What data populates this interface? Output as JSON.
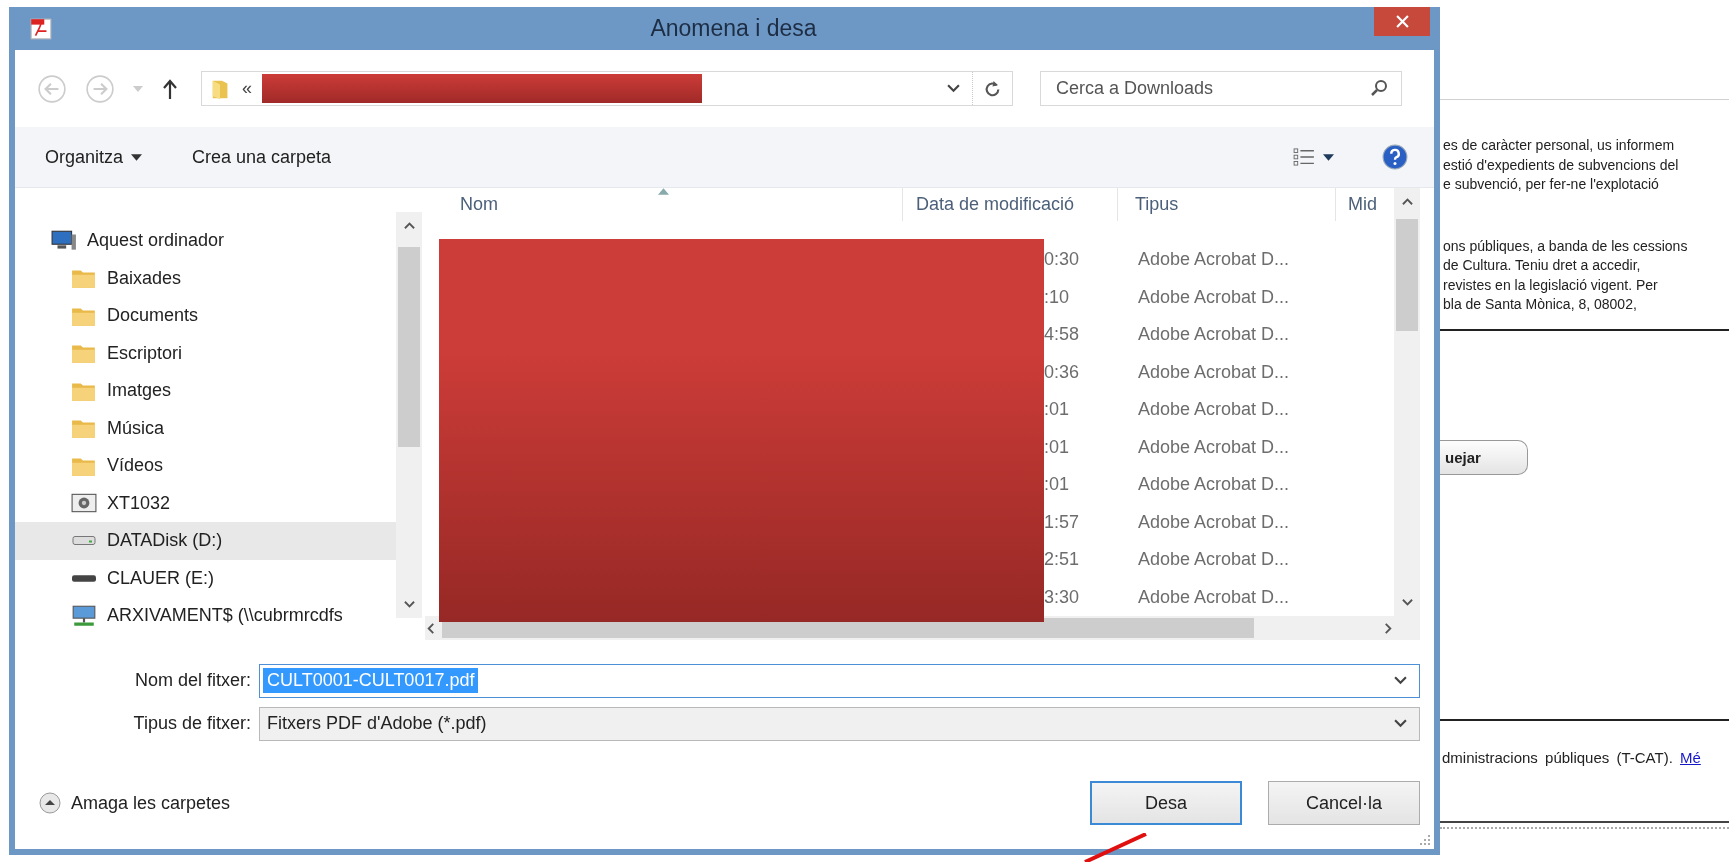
{
  "window": {
    "title": "Anomena i desa"
  },
  "address_bar": {
    "prefix": "«"
  },
  "search": {
    "placeholder": "Cerca a Downloads"
  },
  "toolbar": {
    "organize": "Organitza",
    "new_folder": "Crea una carpeta"
  },
  "navigation": [
    {
      "label": "Aquest ordinador",
      "kind": "computer",
      "selected": false,
      "children": [
        {
          "label": "Baixades",
          "kind": "folder",
          "selected": false
        },
        {
          "label": "Documents",
          "kind": "folder",
          "selected": false
        },
        {
          "label": "Escriptori",
          "kind": "folder",
          "selected": false
        },
        {
          "label": "Imatges",
          "kind": "folder",
          "selected": false
        },
        {
          "label": "Música",
          "kind": "folder",
          "selected": false
        },
        {
          "label": "Vídeos",
          "kind": "folder",
          "selected": false
        },
        {
          "label": "XT1032",
          "kind": "device",
          "selected": false
        },
        {
          "label": "DATADisk (D:)",
          "kind": "drive",
          "selected": true
        },
        {
          "label": "CLAUER (E:)",
          "kind": "removable",
          "selected": false
        },
        {
          "label": "ARXIVAMENT$ (\\\\cubrmrcdfs",
          "kind": "network",
          "selected": false
        }
      ]
    }
  ],
  "columns": [
    {
      "label": "Nom",
      "sorted": true
    },
    {
      "label": "Data de modificació",
      "sorted": false
    },
    {
      "label": "Tipus",
      "sorted": false
    },
    {
      "label": "Mid",
      "sorted": false
    }
  ],
  "rows": [
    {
      "date": "0:30",
      "type": "Adobe Acrobat D..."
    },
    {
      "date": ":10",
      "type": "Adobe Acrobat D..."
    },
    {
      "date": "4:58",
      "type": "Adobe Acrobat D..."
    },
    {
      "date": "0:36",
      "type": "Adobe Acrobat D..."
    },
    {
      "date": ":01",
      "type": "Adobe Acrobat D..."
    },
    {
      "date": ":01",
      "type": "Adobe Acrobat D..."
    },
    {
      "date": ":01",
      "type": "Adobe Acrobat D..."
    },
    {
      "date": "1:57",
      "type": "Adobe Acrobat D..."
    },
    {
      "date": "2:51",
      "type": "Adobe Acrobat D..."
    },
    {
      "date": "3:30",
      "type": "Adobe Acrobat D..."
    }
  ],
  "file_name": {
    "label": "Nom del fitxer:",
    "value": "CULT0001-CULT0017.pdf",
    "value_selected": true
  },
  "file_type": {
    "label": "Tipus de fitxer:",
    "value": "Fitxers PDF d'Adobe (*.pdf)"
  },
  "hide_folders": "Amaga les carpetes",
  "buttons": [
    {
      "label": "Desa",
      "default": true
    },
    {
      "label": "Cancel·la",
      "default": false
    }
  ],
  "background_page": {
    "paragraphs": [
      [
        "es de caràcter personal, us informem",
        "estió d'expedients de subvencions del",
        "e subvenció, per fer-ne l'explotació"
      ],
      [
        "ons públiques, a banda de les cessions",
        "de Cultura. Teniu dret a accedir,",
        "revistes en la legislació vigent. Per",
        "bla de Santa Mònica, 8, 08002,"
      ]
    ],
    "button": "uejar",
    "footer_text": "dministracions públiques (T-CAT).",
    "footer_link": "Mé"
  }
}
